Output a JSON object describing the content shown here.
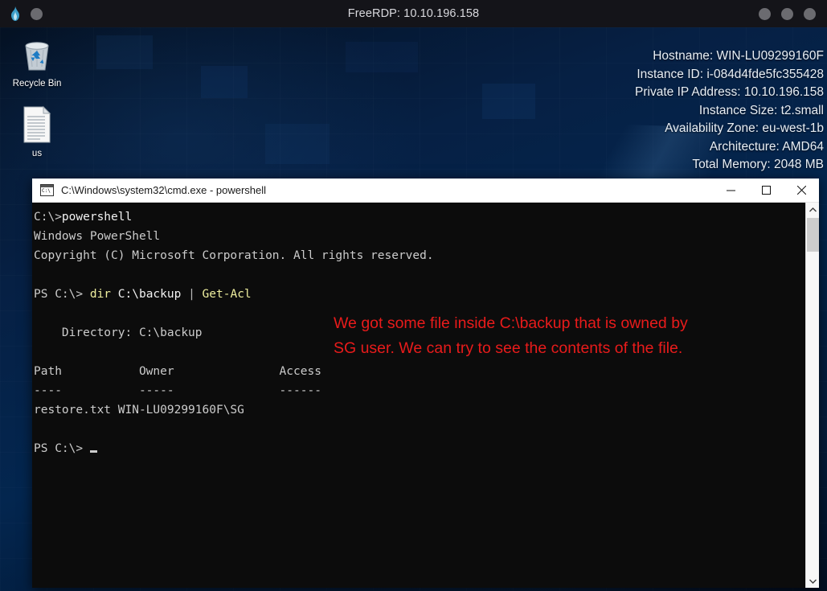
{
  "rdp": {
    "title": "FreeRDP: 10.10.196.158",
    "left_icons": [
      "freerdp-flame-icon",
      "window-menu-button"
    ],
    "right_buttons": [
      "minimize-button",
      "maximize-button",
      "close-button"
    ]
  },
  "desktop": {
    "icons": [
      {
        "name": "recycle-bin",
        "label": "Recycle Bin",
        "glyph": "recycle-bin-icon"
      },
      {
        "name": "text-document",
        "label": "us",
        "glyph": "text-file-icon"
      }
    ],
    "sysinfo": [
      "Hostname: WIN-LU09299160F",
      "Instance ID: i-084d4fde5fc355428",
      "Private IP Address: 10.10.196.158",
      "Instance Size: t2.small",
      "Availability Zone: eu-west-1b",
      "Architecture: AMD64",
      "Total Memory: 2048 MB"
    ]
  },
  "console": {
    "title": "C:\\Windows\\system32\\cmd.exe - powershell",
    "icon": "cmd-icon",
    "window_controls": {
      "minimize": "minimize-button",
      "maximize": "maximize-button",
      "close": "close-button"
    },
    "lines": {
      "l1_prompt": "C:\\>",
      "l1_cmd": "powershell",
      "l2": "Windows PowerShell",
      "l3": "Copyright (C) Microsoft Corporation. All rights reserved.",
      "l5_prompt": "PS C:\\> ",
      "l5_cmd": "dir",
      "l5_arg": " C:\\backup ",
      "l5_pipe": "|",
      "l5_cmd2": " Get-Acl",
      "l7_directory": "    Directory: C:\\backup",
      "l9_head": "Path           Owner               Access",
      "l10_rule": "----           -----               ------",
      "l11_row": "restore.txt WIN-LU09299160F\\SG",
      "l13_prompt": "PS C:\\> "
    },
    "annotation": "We got some file inside C:\\backup that is owned by\nSG user. We can try to see the contents of the file.",
    "annotation_color": "#e81b1b",
    "scrollbar": {
      "up_arrow": "scroll-up-arrow",
      "down_arrow": "scroll-down-arrow",
      "thumb": "scroll-thumb"
    }
  }
}
